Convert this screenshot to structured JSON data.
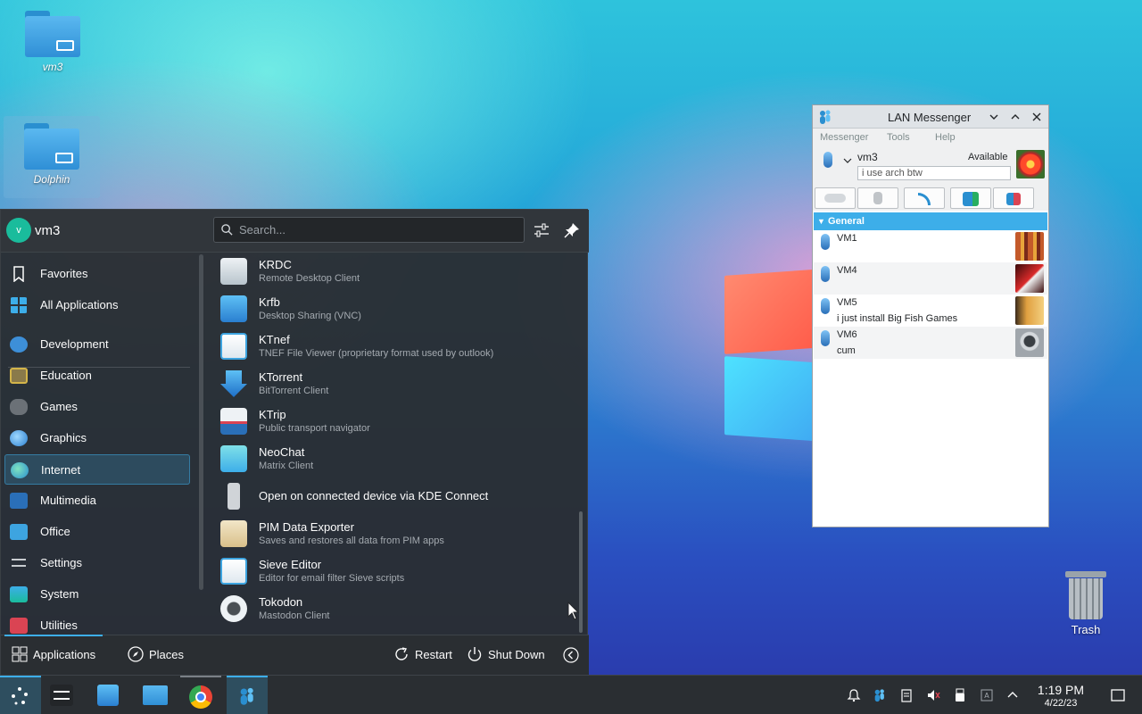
{
  "desktop": {
    "icons": [
      {
        "label": "vm3"
      },
      {
        "label": "Dolphin"
      }
    ],
    "trash_label": "Trash"
  },
  "launcher": {
    "user": {
      "initial": "v",
      "name": "vm3"
    },
    "search": {
      "placeholder": "Search..."
    },
    "categories": [
      {
        "label": "Favorites"
      },
      {
        "label": "All Applications"
      },
      {
        "label": "Development"
      },
      {
        "label": "Education"
      },
      {
        "label": "Games"
      },
      {
        "label": "Graphics"
      },
      {
        "label": "Internet"
      },
      {
        "label": "Multimedia"
      },
      {
        "label": "Office"
      },
      {
        "label": "Settings"
      },
      {
        "label": "System"
      },
      {
        "label": "Utilities"
      }
    ],
    "active_category": "Internet",
    "apps": [
      {
        "name": "KRDC",
        "desc": "Remote Desktop Client"
      },
      {
        "name": "Krfb",
        "desc": "Desktop Sharing (VNC)"
      },
      {
        "name": "KTnef",
        "desc": "TNEF File Viewer (proprietary format used by outlook)"
      },
      {
        "name": "KTorrent",
        "desc": "BitTorrent Client"
      },
      {
        "name": "KTrip",
        "desc": "Public transport navigator"
      },
      {
        "name": "NeoChat",
        "desc": "Matrix Client"
      },
      {
        "name": "Open on connected device via KDE Connect",
        "desc": ""
      },
      {
        "name": "PIM Data Exporter",
        "desc": "Saves and restores all data from PIM apps"
      },
      {
        "name": "Sieve Editor",
        "desc": "Editor for email filter Sieve scripts"
      },
      {
        "name": "Tokodon",
        "desc": "Mastodon Client"
      }
    ],
    "footer": {
      "applications": "Applications",
      "places": "Places",
      "restart": "Restart",
      "shutdown": "Shut Down"
    }
  },
  "messenger": {
    "title": "LAN Messenger",
    "menu": [
      "Messenger",
      "Tools",
      "Help"
    ],
    "user": {
      "name": "vm3",
      "status": "Available",
      "note": "i use arch btw"
    },
    "group": "General",
    "peers": [
      {
        "name": "VM1",
        "message": ""
      },
      {
        "name": "VM4",
        "message": ""
      },
      {
        "name": "VM5",
        "message": "i just install Big Fish Games"
      },
      {
        "name": "VM6",
        "message": "cum"
      }
    ]
  },
  "taskbar": {
    "clock": {
      "time": "1:19 PM",
      "date": "4/22/23"
    }
  },
  "colors": {
    "accent": "#3daee9",
    "panel": "#2a2e32",
    "launcher_bg": "#2a2e32"
  }
}
